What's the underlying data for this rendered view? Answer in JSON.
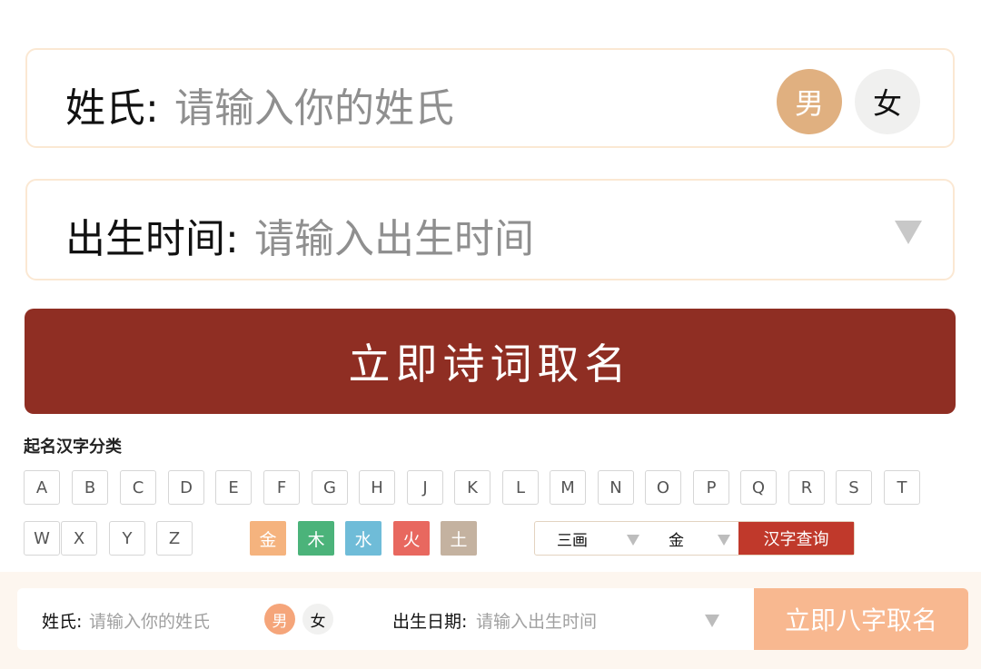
{
  "surname_card": {
    "label": "姓氏:",
    "placeholder": "请输入你的姓氏",
    "male": "男",
    "female": "女"
  },
  "birth_card": {
    "label": "出生时间:",
    "placeholder": "请输入出生时间"
  },
  "cta": {
    "label": "立即诗词取名"
  },
  "classify": {
    "title": "起名汉字分类",
    "letters_row1": [
      "A",
      "B",
      "C",
      "D",
      "E",
      "F",
      "G",
      "H",
      "J",
      "K",
      "L",
      "M",
      "N",
      "O",
      "P",
      "Q",
      "R",
      "S",
      "T"
    ],
    "letters_row2": [
      "W",
      "X",
      "Y",
      "Z"
    ],
    "elements": [
      {
        "label": "金",
        "color": "#f5b37e"
      },
      {
        "label": "木",
        "color": "#4bb37a"
      },
      {
        "label": "水",
        "color": "#6fbcd8"
      },
      {
        "label": "火",
        "color": "#e8685f"
      },
      {
        "label": "土",
        "color": "#c4b2a0"
      }
    ],
    "stroke_select": "三画",
    "element_select": "金",
    "query_button": "汉字查询"
  },
  "bottom": {
    "surname_label": "姓氏:",
    "surname_placeholder": "请输入你的姓氏",
    "male": "男",
    "female": "女",
    "date_label": "出生日期:",
    "date_placeholder": "请输入出生时间",
    "cta": "立即八字取名"
  },
  "colors": {
    "primary": "#8f2e23",
    "male": "#e0b080",
    "query": "#c0392b",
    "bottom_cta": "#f8b890"
  }
}
